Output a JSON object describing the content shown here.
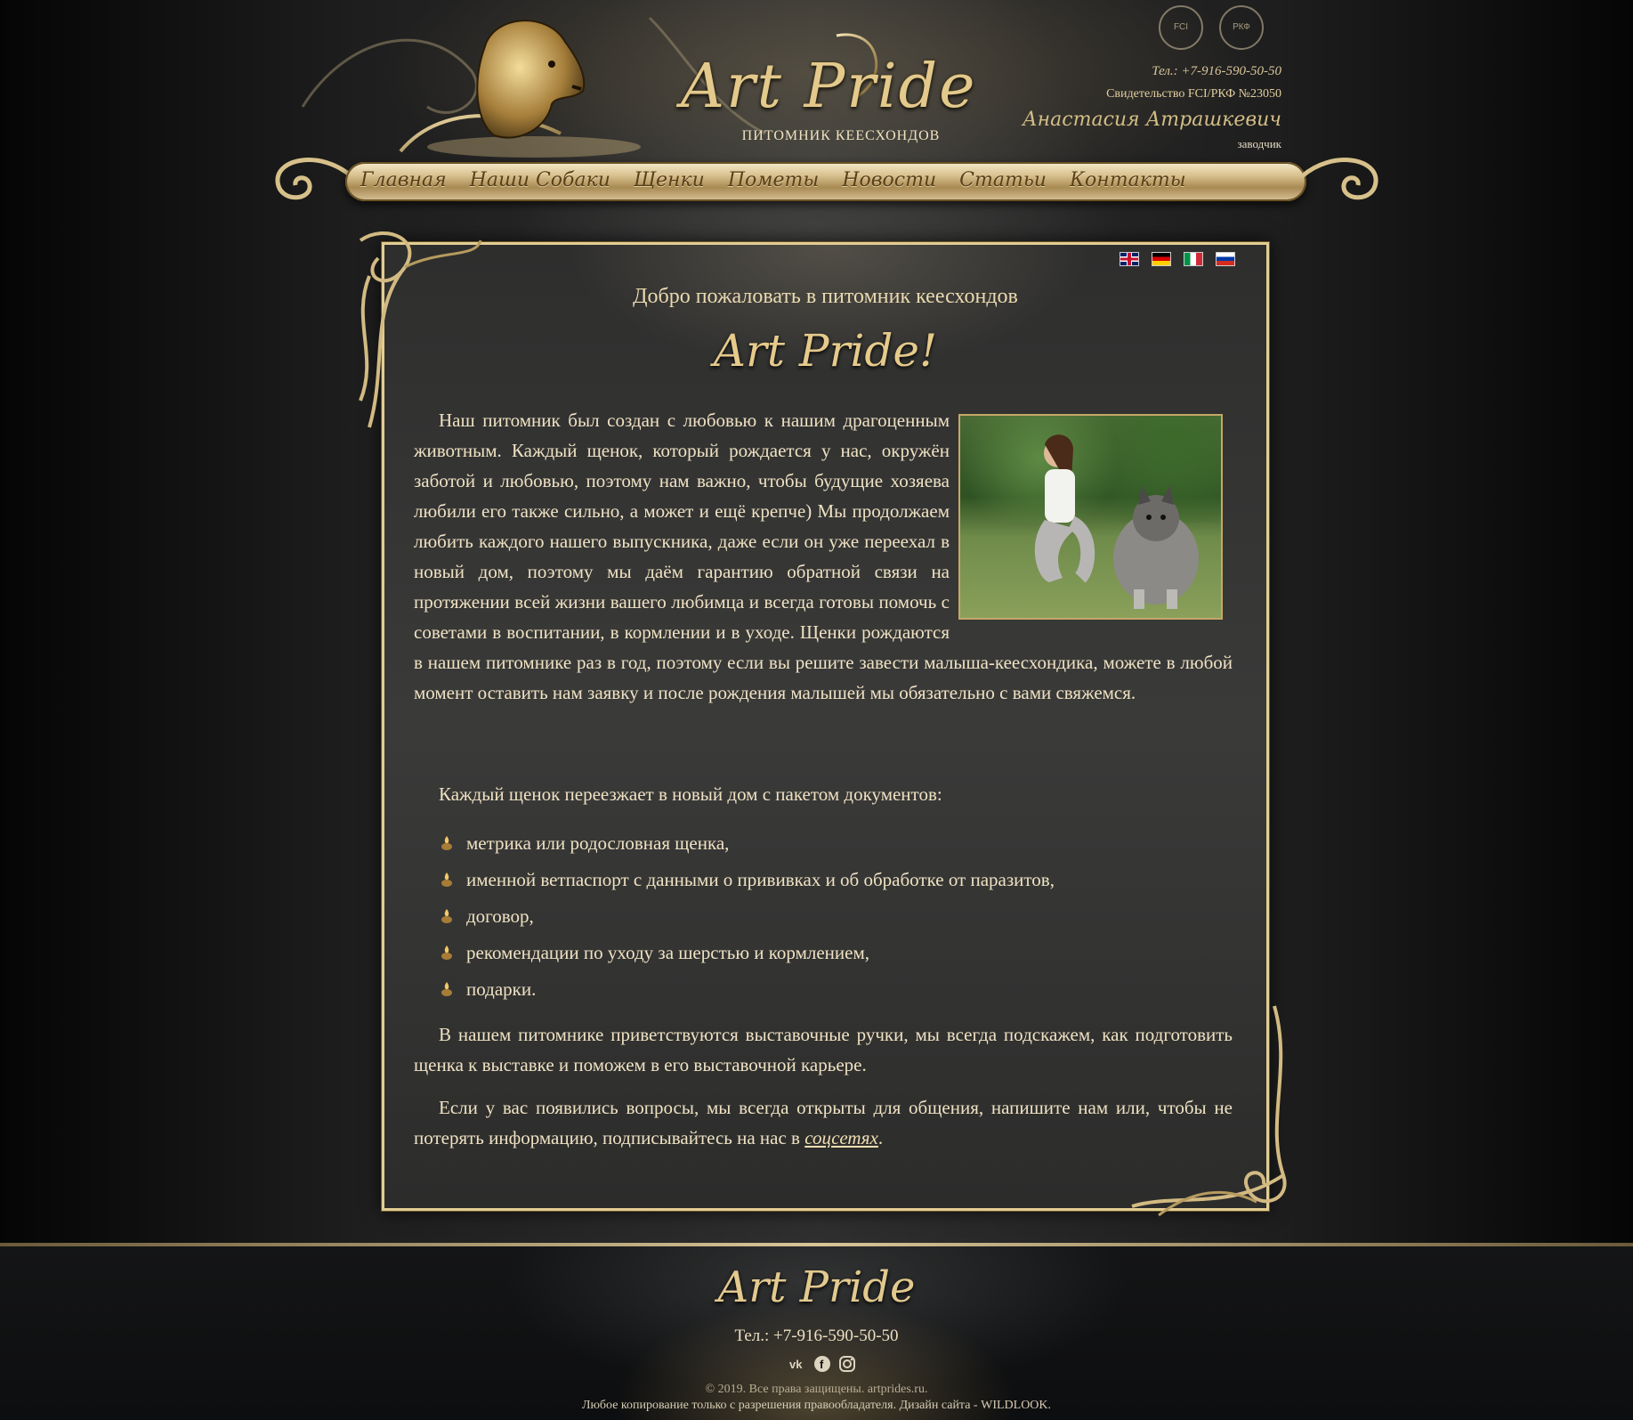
{
  "header": {
    "brand": "Art Pride",
    "subtitle": "ПИТОМНИК КЕЕСХОНДОВ",
    "phone": "Тел.: +7-916-590-50-50",
    "certificate": "Свидетельство FCI/РКФ №23050",
    "breeder_name": "Анастасия Атрашкевич",
    "breeder_role": "заводчик",
    "seal_left": "FCI",
    "seal_right": "РКФ"
  },
  "nav": {
    "items": [
      "Главная",
      "Наши Собаки",
      "Щенки",
      "Пометы",
      "Новости",
      "Статьи",
      "Контакты"
    ]
  },
  "languages": [
    "en",
    "de",
    "it",
    "ru"
  ],
  "content": {
    "welcome": "Добро пожаловать в питомник кеесхондов",
    "brand": "Art Pride!",
    "intro_1": "Наш питомник был создан с любовью к нашим драгоценным животным. Каждый щенок, который рождается у нас, окружён заботой и любовью, поэтому нам важно, чтобы будущие хозяева любили его также сильно, а может и ещё крепче) Мы продолжаем любить каждого нашего выпускника, даже если он уже переехал в новый дом, поэтому мы даём гарантию обратной связи на протяжении всей жизни вашего любимца и всегда готовы помочь с советами в воспитании, в кормлении и в уходе. Щенки рождаются в нашем питомнике раз в год, поэтому если вы решите завести малыша-кеесхондика, можете в любой момент оставить нам заявку и после рождения малышей мы обязательно с вами свяжемся.",
    "docs_lead": "Каждый щенок переезжает в новый дом с пакетом документов:",
    "docs": [
      "метрика или родословная щенка,",
      "именной ветпаспорт с данными о прививках и об обработке от паразитов,",
      "договор,",
      "рекомендации по уходу за шерстью и кормлением,",
      "подарки."
    ],
    "show_text": "В нашем питомнике приветствуются выставочные ручки, мы всегда подскажем, как подготовить щенка к выставке и поможем в его выставочной карьере.",
    "contact_text": "Если у вас появились вопросы, мы всегда открыты для общения, напишите нам или, чтобы не потерять информацию, подписывайтесь на нас в ",
    "social_link": "соцсетях",
    "contact_end": "."
  },
  "footer": {
    "brand": "Art Pride",
    "phone": "Тел.: +7-916-590-50-50",
    "social_icons": [
      "vk-icon",
      "facebook-icon",
      "instagram-icon"
    ],
    "copyright": "© 2019. Все права защищены. artprides.ru.",
    "rights": "Любое копирование только с разрешения правообладателя. Дизайн сайта - WILDLOOK."
  },
  "colors": {
    "gold": "#e2cd94",
    "text": "#efe2c3",
    "nav_text": "#5a4017"
  }
}
